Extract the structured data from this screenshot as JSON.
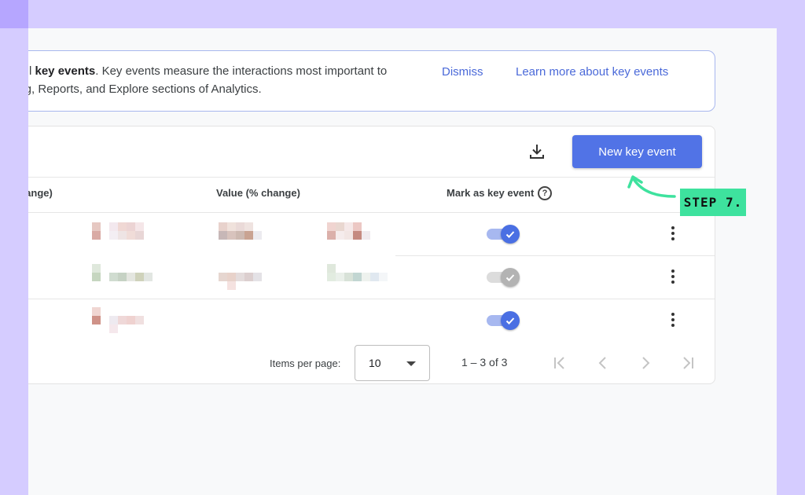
{
  "banner": {
    "line1_prefix": "l ",
    "line1_bold": "key events",
    "line1_rest": ". Key events measure the interactions most important to",
    "line2": "tising, Reports, and Explore sections of Analytics.",
    "dismiss": "Dismiss",
    "learn_more": "Learn more about key events"
  },
  "toolbar": {
    "download_icon": "download-icon",
    "new_key_event": "New key event"
  },
  "table": {
    "columns": [
      " change)",
      "Value (% change)",
      "Mark as key event"
    ],
    "help_glyph": "?",
    "rows": [
      {
        "key_event": true
      },
      {
        "key_event": false
      },
      {
        "key_event": true
      }
    ]
  },
  "pagination": {
    "items_per_page_label": "Items per page:",
    "items_per_page_value": "10",
    "range": "1 – 3 of 3"
  },
  "annotation": {
    "step_label": "STEP 7.",
    "color": "#3ee29e"
  },
  "colors": {
    "accent": "#5173e6",
    "link": "#4a69d9",
    "background": "#d5ccff"
  }
}
